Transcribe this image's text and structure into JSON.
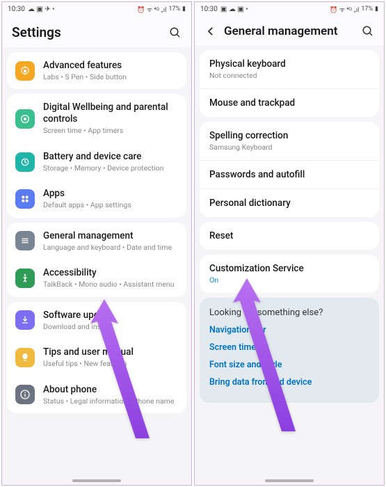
{
  "status": {
    "time": "10:30",
    "battery": "17%"
  },
  "left": {
    "title": "Settings",
    "items": {
      "advanced": {
        "title": "Advanced features",
        "sub": "Labs • S Pen • Side button"
      },
      "wellbeing": {
        "title": "Digital Wellbeing and parental controls",
        "sub": "Screen time • App timers"
      },
      "battery": {
        "title": "Battery and device care",
        "sub": "Storage • Memory • Device protection"
      },
      "apps": {
        "title": "Apps",
        "sub": "Default apps • App settings"
      },
      "general": {
        "title": "General management",
        "sub": "Language and keyboard • Date and time"
      },
      "accessibility": {
        "title": "Accessibility",
        "sub": "TalkBack • Mono audio • Assistant menu"
      },
      "software": {
        "title": "Software update",
        "sub": "Download and install"
      },
      "tips": {
        "title": "Tips and user manual",
        "sub": "Useful tips • New features"
      },
      "about": {
        "title": "About phone",
        "sub": "Status • Legal information • Phone name"
      }
    }
  },
  "right": {
    "title": "General management",
    "items": {
      "physkb": {
        "title": "Physical keyboard",
        "sub": "Not connected"
      },
      "mouse": {
        "title": "Mouse and trackpad"
      },
      "spelling": {
        "title": "Spelling correction",
        "sub": "Samsung Keyboard"
      },
      "passwords": {
        "title": "Passwords and autofill"
      },
      "dictionary": {
        "title": "Personal dictionary"
      },
      "reset": {
        "title": "Reset"
      },
      "custom": {
        "title": "Customization Service",
        "sub": "On"
      }
    },
    "suggest": {
      "heading": "Looking for something else?",
      "links": [
        "Navigation bar",
        "Screen timeout",
        "Font size and style",
        "Bring data from old device"
      ]
    }
  },
  "colors": {
    "orange": "#f5a623",
    "green": "#3bbf8f",
    "teal": "#1fb5a8",
    "blue": "#5b7cf0",
    "gray": "#7a8594",
    "darkgreen": "#2e9b57",
    "purple": "#7c6ef0",
    "yellow": "#f0b940",
    "darkgray": "#6b7280"
  }
}
